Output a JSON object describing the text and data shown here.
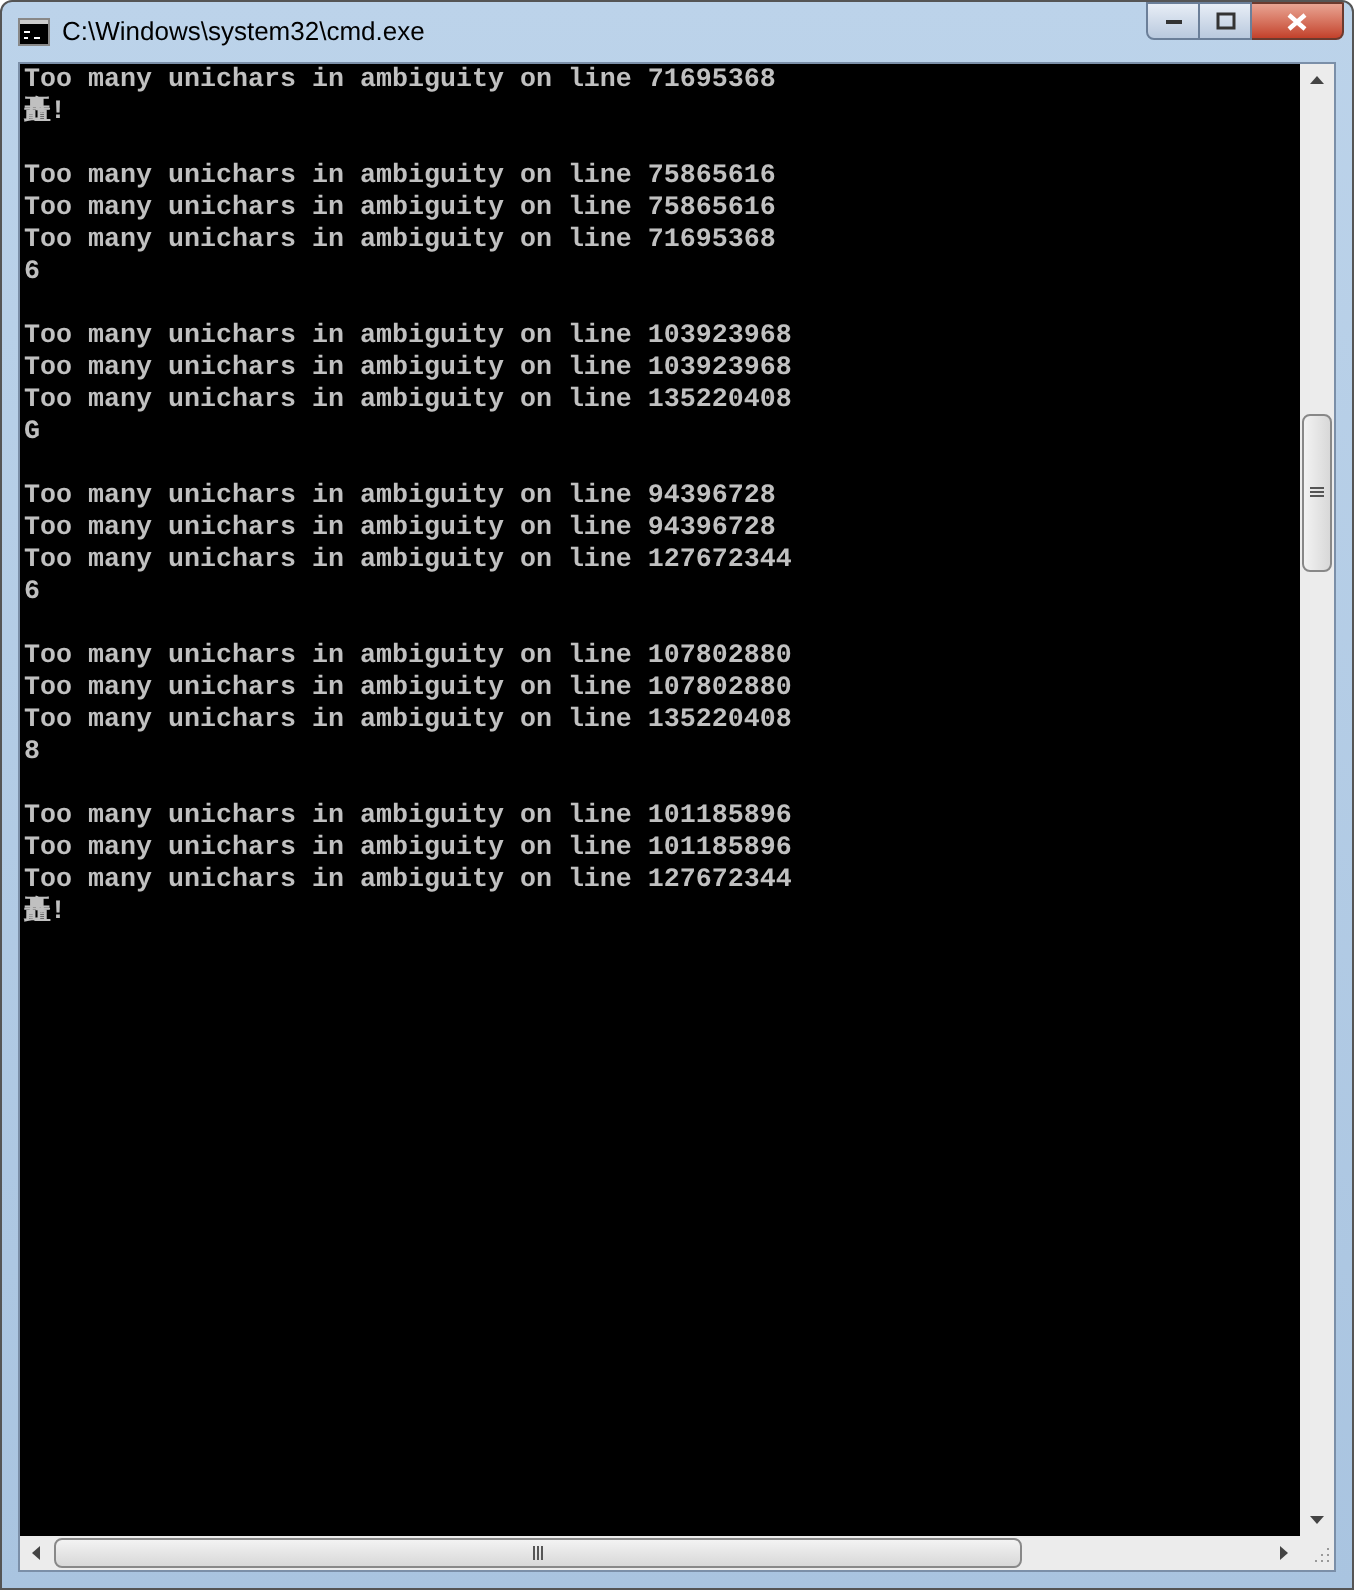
{
  "window": {
    "title": "C:\\Windows\\system32\\cmd.exe"
  },
  "console": {
    "groups": [
      {
        "lines": [
          "Too many unichars in ambiguity on line 71695368",
          "矗!"
        ]
      },
      {
        "lines": [
          "Too many unichars in ambiguity on line 75865616",
          "Too many unichars in ambiguity on line 75865616",
          "Too many unichars in ambiguity on line 71695368",
          "6"
        ]
      },
      {
        "lines": [
          "Too many unichars in ambiguity on line 103923968",
          "Too many unichars in ambiguity on line 103923968",
          "Too many unichars in ambiguity on line 135220408",
          "G"
        ]
      },
      {
        "lines": [
          "Too many unichars in ambiguity on line 94396728",
          "Too many unichars in ambiguity on line 94396728",
          "Too many unichars in ambiguity on line 127672344",
          "6"
        ]
      },
      {
        "lines": [
          "Too many unichars in ambiguity on line 107802880",
          "Too many unichars in ambiguity on line 107802880",
          "Too many unichars in ambiguity on line 135220408",
          "8"
        ]
      },
      {
        "lines": [
          "Too many unichars in ambiguity on line 101185896",
          "Too many unichars in ambiguity on line 101185896",
          "Too many unichars in ambiguity on line 127672344",
          "矗!"
        ]
      }
    ]
  }
}
